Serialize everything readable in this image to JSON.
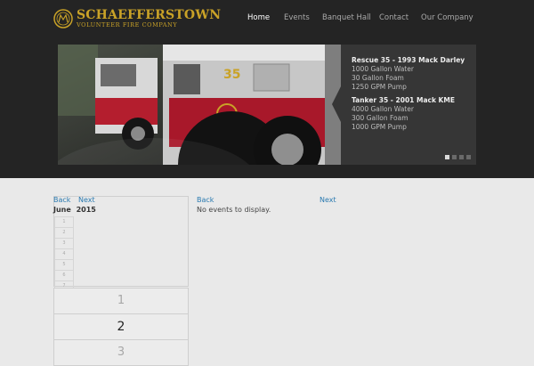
{
  "logo": {
    "title": "SCHAEFFERSTOWN",
    "subtitle": "VOLUNTEER FIRE COMPANY",
    "emblem_text": "SVFC"
  },
  "nav": {
    "items": [
      {
        "label": "Home",
        "active": true
      },
      {
        "label": "Events",
        "active": false
      },
      {
        "label": "Banquet Hall",
        "active": false
      },
      {
        "label": "Contact",
        "active": false
      },
      {
        "label": "Our Company",
        "active": false
      }
    ]
  },
  "slider": {
    "truck_number": "35",
    "trucks": [
      {
        "title": "Rescue 35 - 1993 Mack Darley",
        "specs": [
          "1000 Gallon Water",
          "30 Gallon Foam",
          "1250 GPM Pump"
        ]
      },
      {
        "title": "Tanker 35 - 2001 Mack KME",
        "specs": [
          "4000 Gallon Water",
          "300 Gallon Foam",
          "1000 GPM Pump"
        ]
      }
    ],
    "slide_count": 4,
    "active_slide": 1
  },
  "calendar": {
    "back_label": "Back",
    "next_label": "Next",
    "month": "June",
    "year": "2015",
    "week_numbers": [
      "1",
      "2",
      "3",
      "4",
      "5",
      "6",
      "7"
    ],
    "days": [
      "1",
      "2",
      "3"
    ],
    "selected_day": "2"
  },
  "events": {
    "back_label": "Back",
    "next_label": "Next",
    "empty_message": "No events to display."
  }
}
